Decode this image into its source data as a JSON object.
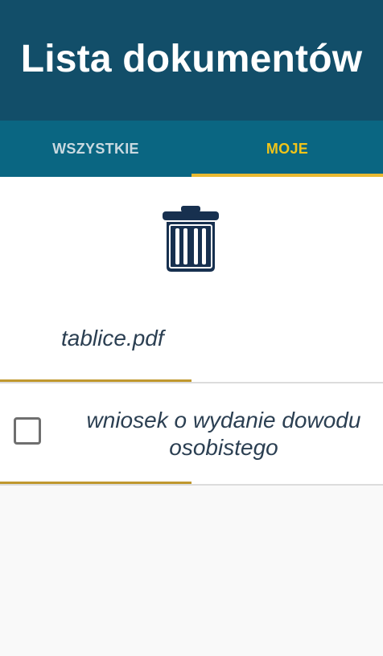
{
  "header": {
    "title": "Lista dokumentów"
  },
  "tabs": [
    {
      "label": "WSZYSTKIE",
      "selected": false
    },
    {
      "label": "MOJE",
      "selected": true
    }
  ],
  "toolbar": {
    "delete_icon": "trash-icon"
  },
  "documents": [
    {
      "name": "tablice.pdf",
      "checkbox_visible": false,
      "checked": false
    },
    {
      "name": "wniosek o wydanie dowodu osobistego",
      "checkbox_visible": true,
      "checked": false
    }
  ],
  "colors": {
    "header_bg": "#124e69",
    "tabs_bg": "#0a6682",
    "tab_active": "#f0c419",
    "accent_gold": "#c0982e",
    "text_dark": "#2b3f52",
    "icon_navy": "#17304f"
  }
}
